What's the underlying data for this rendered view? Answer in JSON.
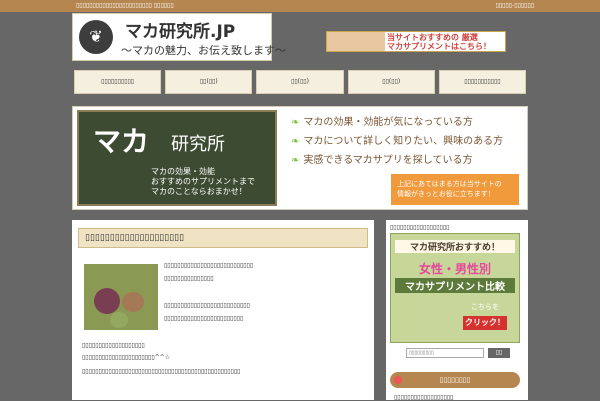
{
  "topbar": {
    "left_text": "▯▯▯▯▯▯▯▯▯▯▯▯▯▯▯▯▯▯▯▯▯▯▯ ▯▯▯▯▯▯",
    "right_text": "▯▯▯▯▯-▯▯▯▯▯▯"
  },
  "logo": {
    "title": "マカ研究所.JP",
    "tagline": "〜マカの魅力、お伝え致します〜",
    "icon": "bird-leaf-icon"
  },
  "banner": {
    "line1": "当サイトおすすめの 厳選",
    "line2": "マカサプリメントはこちら！"
  },
  "nav": {
    "items": [
      "▯▯▯▯▯▯▯▯▯▯",
      "▯▯(▯▯)",
      "▯▯(▯▯)",
      "▯▯(▯▯)",
      "▯▯▯▯▯▯▯▯▯▯▯"
    ]
  },
  "hero": {
    "board_title": "マカ",
    "board_title2": "研究所",
    "board_lines": [
      "マカの効果・効能",
      "おすすめのサプリメントまで",
      "マカのことならおまかせ！"
    ],
    "checks": [
      "マカの効果・効能が気になっている方",
      "マカについて詳しく知りたい、興味のある方",
      "実感できるマカサプリを探している方"
    ],
    "orange_line1": "上記にあてはまる方は当サイトの",
    "orange_line2": "情報がきっとお役に立ちます！"
  },
  "main": {
    "title": "▯▯▯▯▯▯▯▯▯▯▯▯▯▯▯▯▯▯▯▯",
    "para": [
      "▯▯▯▯▯▯▯▯▯▯▯▯▯▯▯▯▯▯▯▯▯▯▯▯▯▯▯",
      "▯▯▯▯▯▯▯▯▯▯▯▯▯▯▯",
      "▯▯▯▯▯▯▯▯▯▯▯▯▯▯▯▯▯▯▯▯▯▯▯▯▯▯",
      "▯▯▯▯▯▯▯▯▯▯▯▯▯▯▯▯▯▯▯▯▯▯▯▯",
      "▯▯▯▯▯▯▯▯▯▯▯▯▯▯▯▯▯▯▯",
      "▯▯▯▯▯▯▯▯▯▯▯▯▯▯▯▯▯▯▯▯▯▯^^☆",
      "▯▯▯▯▯▯▯▯▯▯▯▯▯▯▯▯▯▯▯▯▯▯▯▯▯▯▯▯▯▯▯▯▯▯▯▯▯▯▯▯▯▯▯▯▯▯▯▯"
    ]
  },
  "side": {
    "title": "▯▯▯▯▯▯▯▯▯▯▯▯▯▯▯▯▯▯",
    "ad_line1": "マカ研究所おすすめ！",
    "ad_line2": "女性・男性別",
    "ad_line3": "マカサプリメント比較",
    "ad_line4": "こちらを",
    "ad_button": "クリック！",
    "search_placeholder": "▯▯▯▯▯▯▯▯▯",
    "search_button": "▯▯",
    "section_head": "▯▯▯▯▯▯▯▯",
    "list_item": "▯▯▯▯▯▯▯▯▯▯▯▯▯▯▯▯▯▯"
  }
}
